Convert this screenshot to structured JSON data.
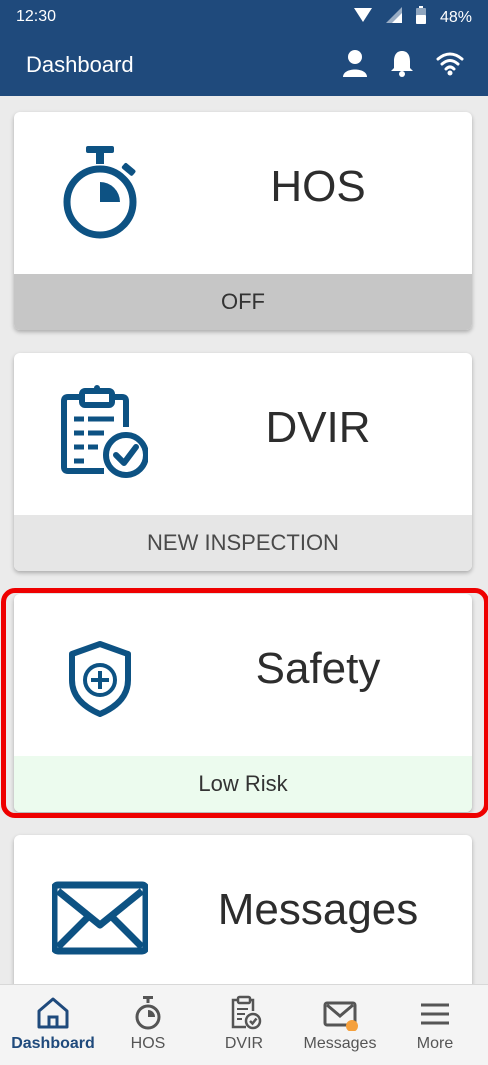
{
  "status_bar": {
    "time": "12:30",
    "battery": "48%"
  },
  "app_bar": {
    "title": "Dashboard"
  },
  "cards": [
    {
      "title": "HOS",
      "footer": "OFF"
    },
    {
      "title": "DVIR",
      "footer": "NEW INSPECTION"
    },
    {
      "title": "Safety",
      "footer": "Low Risk"
    },
    {
      "title": "Messages"
    }
  ],
  "bottom_nav": [
    {
      "label": "Dashboard",
      "icon": "home-icon"
    },
    {
      "label": "HOS",
      "icon": "stopwatch-icon"
    },
    {
      "label": "DVIR",
      "icon": "clipboard-check-icon"
    },
    {
      "label": "Messages",
      "icon": "envelope-icon"
    },
    {
      "label": "More",
      "icon": "menu-icon"
    }
  ],
  "colors": {
    "primary": "#1f4a7c",
    "icon": "#0d5283",
    "highlight": "#ee0000",
    "notification_dot": "#f5a03c",
    "low_risk_bg": "#ecfbee"
  }
}
